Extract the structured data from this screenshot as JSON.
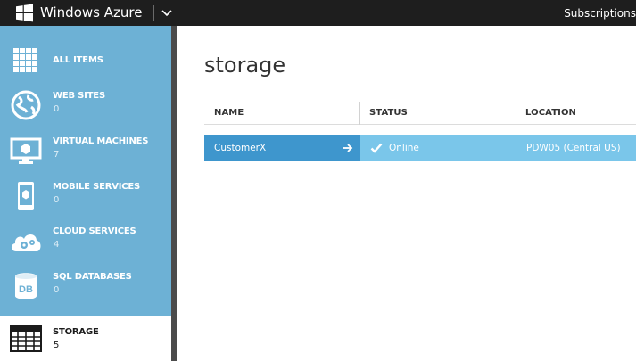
{
  "header": {
    "brand": "Windows Azure",
    "subscriptions_label": "Subscriptions"
  },
  "sidebar": {
    "items": [
      {
        "label": "ALL ITEMS",
        "count": "",
        "icon": "grid-icon"
      },
      {
        "label": "WEB SITES",
        "count": "0",
        "icon": "globe-icon"
      },
      {
        "label": "VIRTUAL MACHINES",
        "count": "7",
        "icon": "monitor-icon"
      },
      {
        "label": "MOBILE SERVICES",
        "count": "0",
        "icon": "phone-icon"
      },
      {
        "label": "CLOUD SERVICES",
        "count": "4",
        "icon": "cloud-gears-icon"
      },
      {
        "label": "SQL DATABASES",
        "count": "0",
        "icon": "database-icon"
      },
      {
        "label": "STORAGE",
        "count": "5",
        "icon": "table-icon",
        "active": true
      }
    ]
  },
  "main": {
    "title": "storage",
    "columns": [
      "NAME",
      "STATUS",
      "LOCATION"
    ],
    "rows": [
      {
        "name": "CustomerX",
        "status": "Online",
        "location": "PDW05 (Central US)"
      }
    ]
  },
  "colors": {
    "topbar": "#1e1e1e",
    "sidebar": "#6db1d5",
    "selected_name_cell": "#3e96cd",
    "selected_row": "#7ac6ea"
  }
}
